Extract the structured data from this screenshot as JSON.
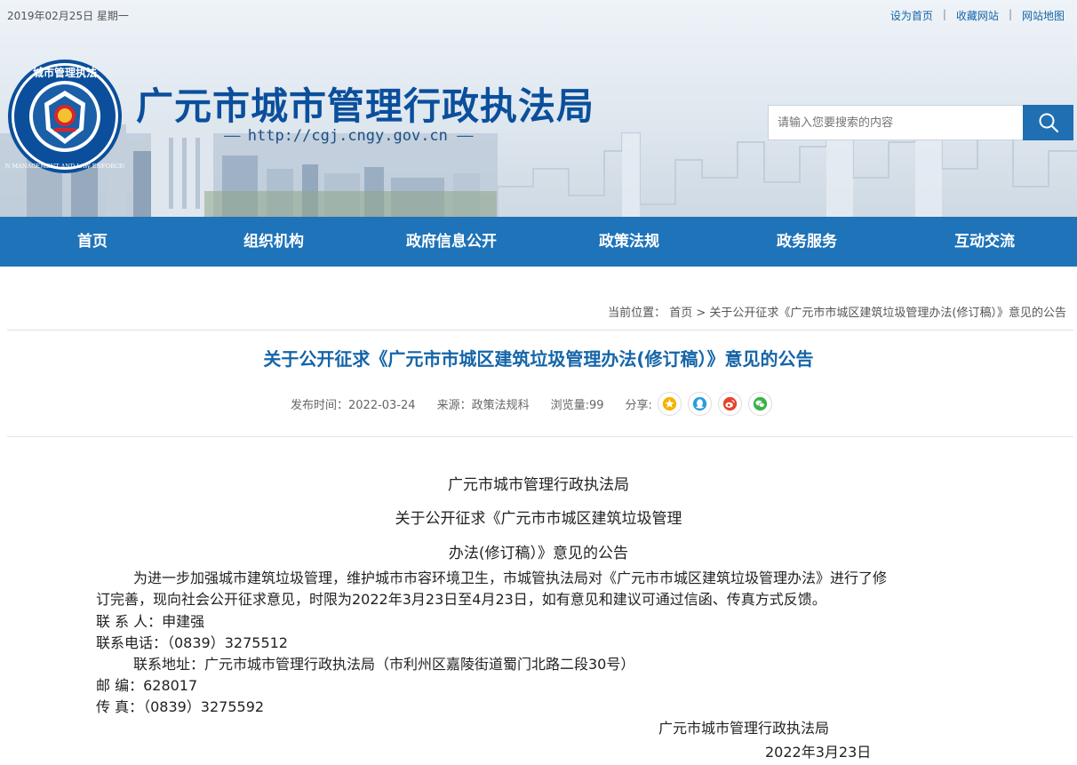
{
  "topbar": {
    "date": "2019年02月25日 星期一",
    "links": [
      "设为首页",
      "收藏网站",
      "网站地图"
    ],
    "separator": "|"
  },
  "site": {
    "title": "广元市城市管理行政执法局",
    "url": "http://cgj.cngy.gov.cn",
    "dash": "——",
    "logo_top_text": "城市管理执法",
    "logo_ring_text": "URBAN MANAGEMENT AND LAW ENFORCEMENT"
  },
  "search": {
    "placeholder": "请输入您要搜索的内容"
  },
  "nav": {
    "items": [
      "首页",
      "组织机构",
      "政府信息公开",
      "政策法规",
      "政务服务",
      "互动交流"
    ]
  },
  "breadcrumb": {
    "label": "当前位置：",
    "home": "首页",
    "arrow": ">",
    "current": "关于公开征求《广元市市城区建筑垃圾管理办法(修订稿）》意见的公告"
  },
  "article": {
    "title": "关于公开征求《广元市市城区建筑垃圾管理办法(修订稿）》意见的公告",
    "meta": {
      "publish": "发布时间：2022-03-24",
      "source": "来源：政策法规科",
      "views": "浏览量:99",
      "share_label": "分享:"
    },
    "share_icons": [
      "star-icon",
      "qq-icon",
      "weibo-icon",
      "wechat-icon"
    ],
    "body": {
      "org": "广元市城市管理行政执法局",
      "heading_line1": "关于公开征求《广元市市城区建筑垃圾管理",
      "heading_line2": "办法(修订稿）》意见的公告",
      "para_line1": "为进一步加强城市建筑垃圾管理，维护城市市容环境卫生，市城管执法局对《广元市市城区建筑垃圾管理办法》进行了修",
      "para_line2": "订完善，现向社会公开征求意见，时限为2022年3月23日至4月23日，如有意见和建议可通过信函、传真方式反馈。",
      "contact": "联 系 人：申建强",
      "phone": "联系电话：（0839）3275512",
      "address": "联系地址：广元市城市管理行政执法局（市利州区嘉陵街道蜀门北路二段30号）",
      "postcode": "邮 编：628017",
      "fax": "传 真：（0839）3275592",
      "signature": "广元市城市管理行政执法局",
      "date": "2022年3月23日"
    }
  },
  "colors": {
    "nav_bg": "#1e73b9",
    "title_blue": "#0b4f9c",
    "link_blue": "#1565a8"
  }
}
